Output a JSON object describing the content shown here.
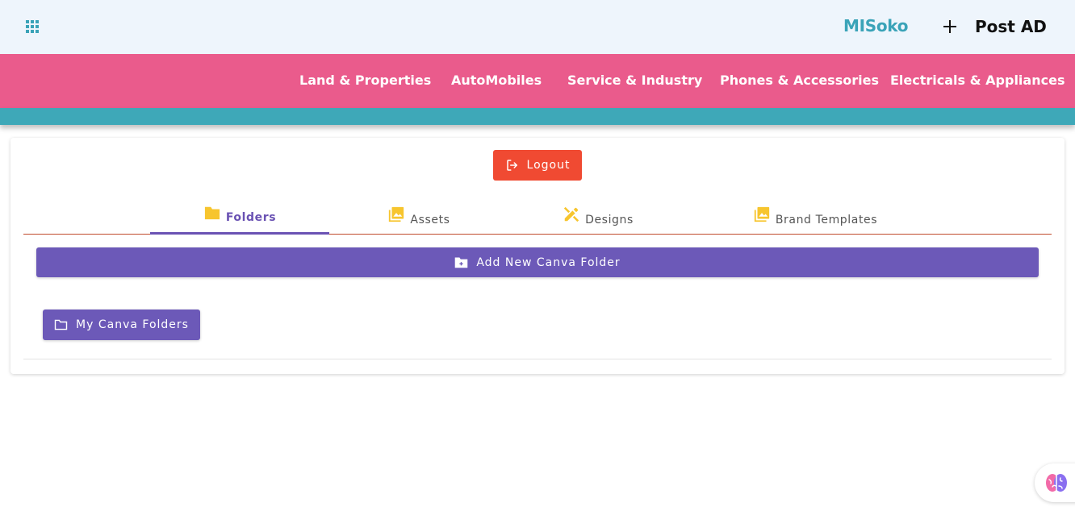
{
  "header": {
    "brand": "MISoko",
    "post_ad_label": "Post AD"
  },
  "nav": {
    "items": [
      {
        "label": "Land & Properties"
      },
      {
        "label": "AutoMobiles"
      },
      {
        "label": "Service & Industry"
      },
      {
        "label": "Phones & Accessories"
      },
      {
        "label": "Electricals & Appliances"
      }
    ]
  },
  "card": {
    "logout_label": "Logout",
    "tabs": [
      {
        "label": "Folders",
        "icon": "folder-icon",
        "active": true
      },
      {
        "label": "Assets",
        "icon": "image-stack-icon",
        "active": false
      },
      {
        "label": "Designs",
        "icon": "design-tools-icon",
        "active": false
      },
      {
        "label": "Brand Templates",
        "icon": "image-stack-icon",
        "active": false
      }
    ],
    "add_folder_label": "Add New Canva Folder",
    "my_folders_label": "My Canva Folders"
  },
  "colors": {
    "brand": "#3aa3b8",
    "nav_pink": "#ea5b8c",
    "teal_bar": "#3ea8b8",
    "logout_red": "#f04a32",
    "purple": "#6c59b8",
    "tab_icon_yellow": "#f7c52e"
  }
}
